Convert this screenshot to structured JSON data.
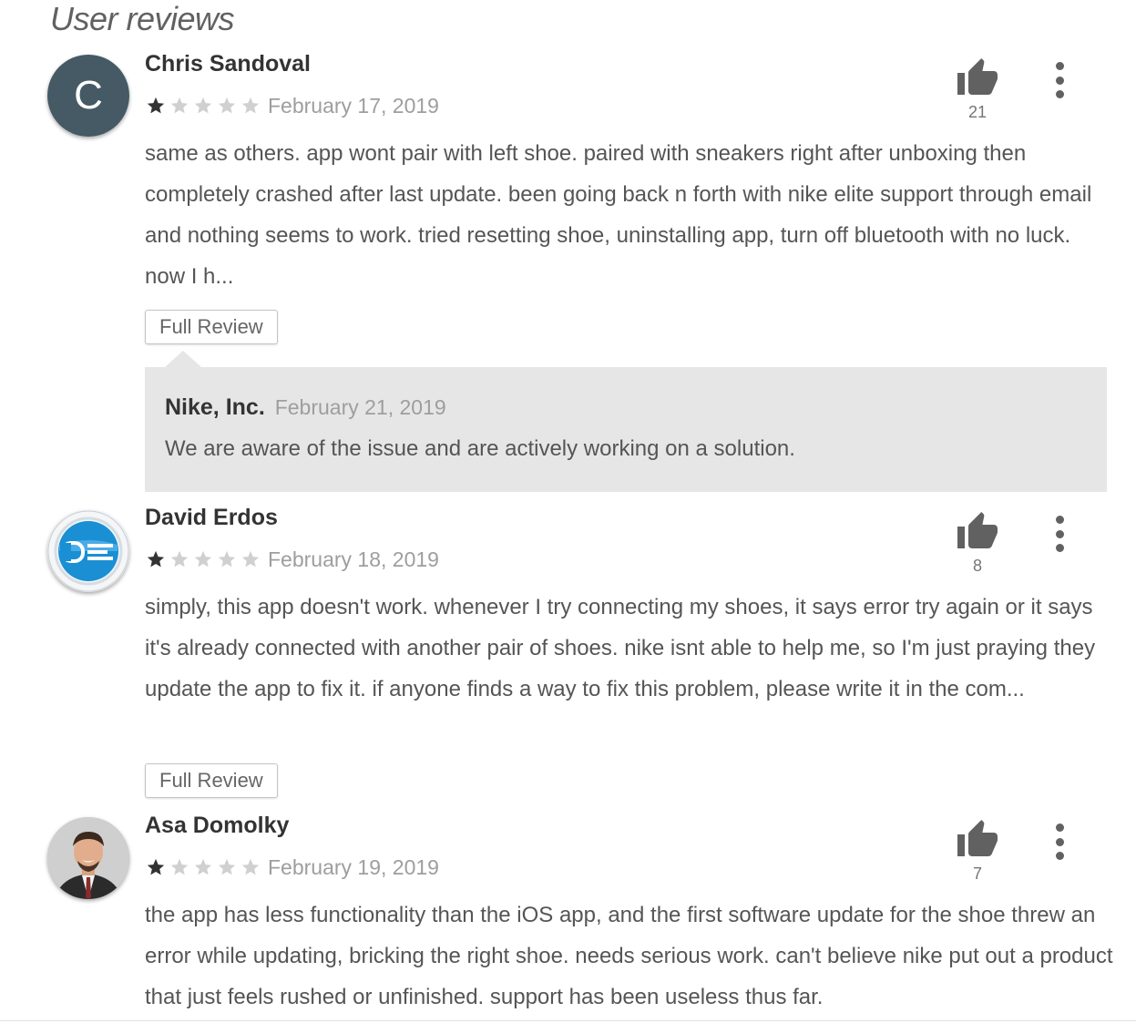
{
  "section_title": "User reviews",
  "colors": {
    "star_filled": "#333333",
    "star_empty": "#d0d0d0",
    "reply_bg": "#e6e6e6",
    "avatar_bg": "#455a64"
  },
  "reviews": [
    {
      "author": "Chris Sandoval",
      "avatar_letter": "C",
      "rating": 1,
      "date": "February 17, 2019",
      "likes": "21",
      "text": "same as others. app wont pair with left shoe. paired with sneakers right after unboxing then completely crashed after last update. been going back n forth with nike elite support through email and nothing seems to work. tried resetting shoe, uninstalling app, turn off bluetooth with no luck. now I h...",
      "full_review_label": "Full Review",
      "reply": {
        "author": "Nike, Inc.",
        "date": "February 21, 2019",
        "text": "We are aware of the issue and are actively working on a solution."
      }
    },
    {
      "author": "David Erdos",
      "rating": 1,
      "date": "February 18, 2019",
      "likes": "8",
      "text": "simply, this app doesn't work. whenever I try connecting my shoes, it says error try again or it says it's already connected with another pair of shoes. nike isnt able to help me, so I'm just praying they update the app to fix it. if anyone finds a way to fix this problem, please write it in the com...",
      "full_review_label": "Full Review"
    },
    {
      "author": "Asa Domolky",
      "rating": 1,
      "date": "February 19, 2019",
      "likes": "7",
      "text": "the app has less functionality than the iOS app, and the first software update for the shoe threw an error while updating, bricking the right shoe. needs serious work. can't believe nike put out a product that just feels rushed or unfinished. support has been useless thus far."
    }
  ]
}
